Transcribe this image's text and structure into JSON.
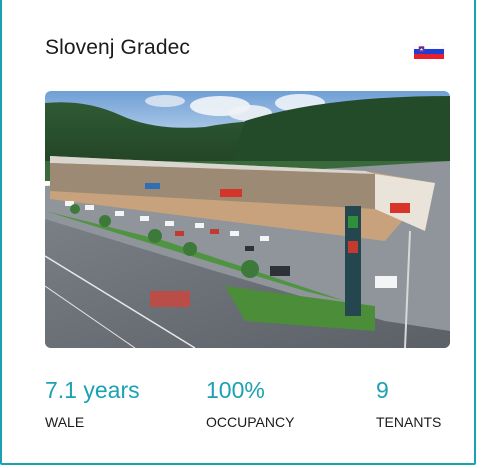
{
  "property": {
    "name": "Slovenj Gradec",
    "flag_icon": "slovenia-flag-icon",
    "photo_alt": "Shopping centre in Slovenj Gradec",
    "stats": [
      {
        "value": "7.1 years",
        "label": "WALE"
      },
      {
        "value": "100%",
        "label": "OCCUPANCY"
      },
      {
        "value": "9",
        "label": "TENANTS"
      }
    ]
  },
  "colors": {
    "accent": "#1aa2b3",
    "text": "#1b1b1b",
    "flag_white": "#ffffff",
    "flag_blue": "#1f3ed3",
    "flag_red": "#e8202a"
  }
}
